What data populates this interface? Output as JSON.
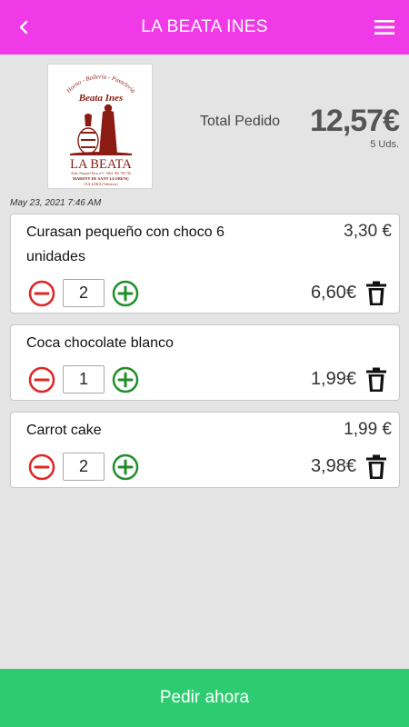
{
  "header": {
    "title": "LA BEATA INES",
    "back_icon": "chevron-left-icon",
    "menu_icon": "hamburger-menu-icon",
    "background_color": "#f13ae7"
  },
  "logo": {
    "lines": [
      "Horno - Bollería - Pastelería",
      "Beata Ines",
      "LA BEATA",
      "Avda. Nazaret Oliva, nº3 - Telef. 961 760 726",
      "MARENY DE SANT LLORENÇ",
      "CULLERA (Valencia)"
    ],
    "color": "#8a1c14"
  },
  "summary": {
    "total_label": "Total Pedido",
    "total_amount": "12,57€",
    "units": "5 Uds."
  },
  "order_timestamp": "May 23, 2021  7:46 AM",
  "items": [
    {
      "name": "Curasan pequeño con choco 6 unidades",
      "unit_price": "3,30 €",
      "quantity": "2",
      "line_total": "6,60€"
    },
    {
      "name": "Coca chocolate blanco",
      "unit_price": "",
      "quantity": "1",
      "line_total": "1,99€"
    },
    {
      "name": "Carrot cake",
      "unit_price": "1,99 €",
      "quantity": "2",
      "line_total": "3,98€"
    }
  ],
  "icons": {
    "decrease": "minus-circle-icon",
    "increase": "plus-circle-icon",
    "delete": "trash-icon"
  },
  "colors": {
    "decrease": "#e02525",
    "increase": "#1f8f2b",
    "cta": "#2ecc71",
    "background": "#e4e4e4"
  },
  "cta": {
    "label": "Pedir ahora"
  }
}
